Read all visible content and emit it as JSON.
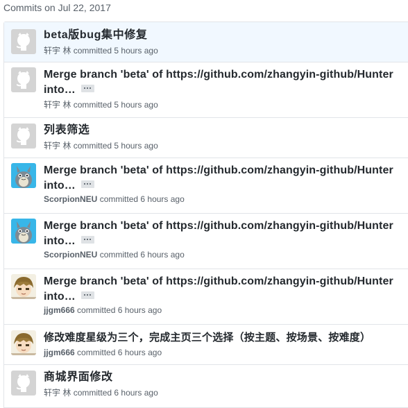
{
  "header": {
    "date_label": "Commits on Jul 22, 2017"
  },
  "commits": [
    {
      "message": "beta版bug集中修复",
      "author": "轩宇 林",
      "verb": "committed",
      "time": "5 hours ago",
      "avatar": "identicon-icon"
    },
    {
      "message": "Merge branch 'beta' of https://github.com/zhangyin-github/Hunter",
      "message_cont": "into…",
      "author": "轩宇 林",
      "verb": "committed",
      "time": "5 hours ago",
      "avatar": "identicon-icon"
    },
    {
      "message": "列表筛选",
      "author": "轩宇 林",
      "verb": "committed",
      "time": "5 hours ago",
      "avatar": "identicon-icon"
    },
    {
      "message": "Merge branch 'beta' of https://github.com/zhangyin-github/Hunter",
      "message_cont": "into…",
      "author": "ScorpionNEU",
      "verb": "committed",
      "time": "6 hours ago",
      "avatar": "totoro-avatar-icon"
    },
    {
      "message": "Merge branch 'beta' of https://github.com/zhangyin-github/Hunter",
      "message_cont": "into…",
      "author": "ScorpionNEU",
      "verb": "committed",
      "time": "6 hours ago",
      "avatar": "totoro-avatar-icon"
    },
    {
      "message": "Merge branch 'beta' of https://github.com/zhangyin-github/Hunter",
      "message_cont": "into…",
      "author": "jjgm666",
      "verb": "committed",
      "time": "6 hours ago",
      "avatar": "anime-avatar-icon"
    },
    {
      "message": "修改难度星级为三个，完成主页三个选择（按主题、按场景、按难度）",
      "author": "jjgm666",
      "verb": "committed",
      "time": "6 hours ago",
      "avatar": "anime-avatar-icon"
    },
    {
      "message": "商城界面修改",
      "author": "轩宇 林",
      "verb": "committed",
      "time": "6 hours ago",
      "avatar": "identicon-icon"
    }
  ],
  "colors": {
    "highlight_row": "#f1f8ff",
    "border": "#e1e4e8",
    "muted_text": "#586069",
    "title_text": "#24292e"
  }
}
